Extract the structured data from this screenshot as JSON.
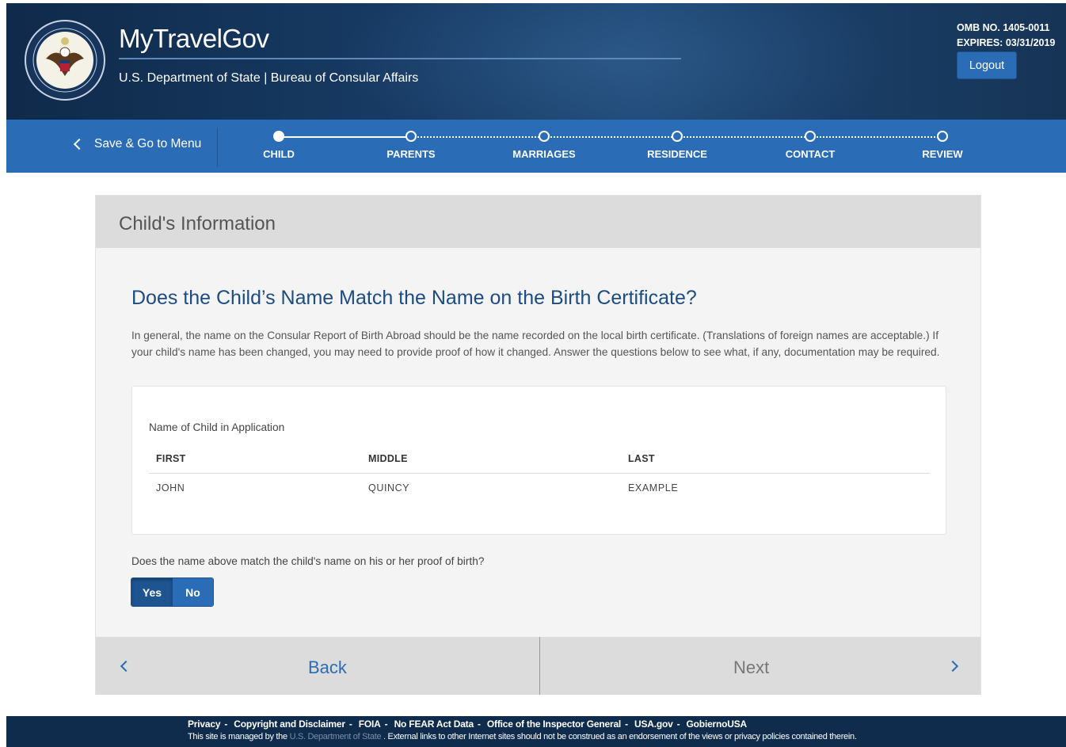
{
  "header": {
    "title": "MyTravelGov",
    "subtitle": "U.S. Department of State | Bureau of Consular Affairs",
    "omb": "OMB NO. 1405-0011",
    "expires": "EXPIRES: 03/31/2019",
    "logout_label": "Logout"
  },
  "progress": {
    "save_menu_label": "Save & Go to Menu",
    "steps": [
      {
        "label": "CHILD",
        "active": true
      },
      {
        "label": "PARENTS",
        "active": false
      },
      {
        "label": "MARRIAGES",
        "active": false
      },
      {
        "label": "RESIDENCE",
        "active": false
      },
      {
        "label": "CONTACT",
        "active": false
      },
      {
        "label": "REVIEW",
        "active": false
      }
    ]
  },
  "card": {
    "heading": "Child's Information",
    "question_title": "Does the Child’s Name Match the Name on the Birth Certificate?",
    "intro": "In general, the name on the Consular Report of Birth Abroad should be the name recorded on the local birth certificate. (Translations of foreign names are acceptable.) If your child's name has been changed, you may need to provide proof of how it changed. Answer the questions below to see what, if any, documentation may be required.",
    "name_box": {
      "caption": "Name of Child in Application",
      "columns": [
        "FIRST",
        "MIDDLE",
        "LAST"
      ],
      "values": [
        "JOHN",
        "QUINCY",
        "EXAMPLE"
      ]
    },
    "match_question": "Does the name above match the child's name on his or her proof of birth?",
    "options": {
      "yes": "Yes",
      "no": "No",
      "selected": "Yes"
    },
    "back_label": "Back",
    "next_label": "Next"
  },
  "footer": {
    "links": [
      "Privacy",
      "Copyright and Disclaimer",
      "FOIA",
      "No FEAR Act Data",
      "Office of the Inspector General",
      "USA.gov",
      "GobiernoUSA"
    ],
    "notice_prefix": "This site is managed by the",
    "notice_link": "U.S. Department of State",
    "notice_suffix": ". External links to other Internet sites should not be construed as an endorsement of the views or privacy policies contained therein."
  },
  "colors": {
    "header_navy": "#173a63",
    "step_blue": "#2a6cb6",
    "title_blue": "#1d4c82",
    "footer_navy": "#102c4d"
  }
}
